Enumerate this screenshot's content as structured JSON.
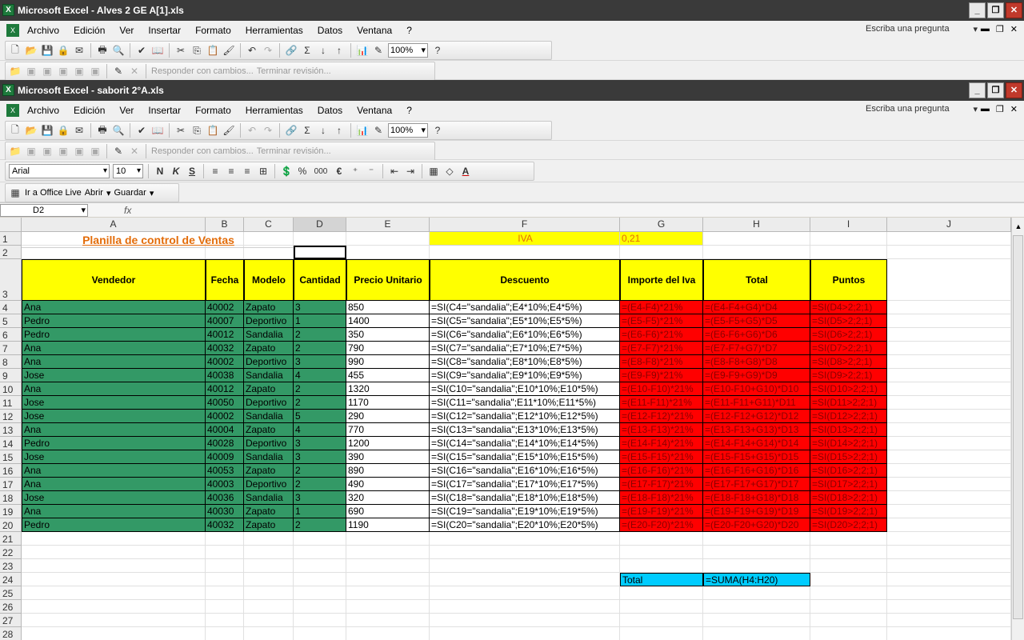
{
  "window1": {
    "title": "Microsoft Excel - Alves 2 GE A[1].xls"
  },
  "window2": {
    "title": "Microsoft Excel - saborit 2°A.xls"
  },
  "menu": {
    "items": [
      "Archivo",
      "Edición",
      "Ver",
      "Insertar",
      "Formato",
      "Herramientas",
      "Datos",
      "Ventana",
      "?"
    ],
    "ask_placeholder": "Escriba una pregunta"
  },
  "toolbar": {
    "zoom": "100%",
    "review_reply": "Responder con cambios...",
    "review_end": "Terminar revisión...",
    "font_name": "Arial",
    "font_size": "10",
    "bold": "N",
    "italic": "K",
    "underline": "S",
    "percent": "%",
    "thousands": "000",
    "euro": "€"
  },
  "office_live": {
    "go": "Ir a Office Live",
    "open": "Abrir",
    "save": "Guardar"
  },
  "formula_bar": {
    "name_box": "D2",
    "fx": "fx"
  },
  "sheet": {
    "columns": [
      "A",
      "B",
      "C",
      "D",
      "E",
      "F",
      "G",
      "H",
      "I",
      "J"
    ],
    "title": "Planilla de control de Ventas",
    "iva_label": "IVA",
    "iva_value": "0,21",
    "headers": [
      "Vendedor",
      "Fecha",
      "Modelo",
      "Cantidad",
      "Precio Unitario",
      "Descuento",
      "Importe del Iva",
      "Total",
      "Puntos"
    ],
    "rows": [
      [
        "Ana",
        "40002",
        "Zapato",
        "3",
        "850",
        "=SI(C4=\"sandalia\";E4*10%;E4*5%)",
        "=(E4-F4)*21%",
        "=(E4-F4+G4)*D4",
        "=SI(D4>2;2;1)"
      ],
      [
        "Pedro",
        "40007",
        "Deportivo",
        "1",
        "1400",
        "=SI(C5=\"sandalia\";E5*10%;E5*5%)",
        "=(E5-F5)*21%",
        "=(E5-F5+G5)*D5",
        "=SI(D5>2;2;1)"
      ],
      [
        "Pedro",
        "40012",
        "Sandalia",
        "2",
        "350",
        "=SI(C6=\"sandalia\";E6*10%;E6*5%)",
        "=(E6-F6)*21%",
        "=(E6-F6+G6)*D6",
        "=SI(D6>2;2;1)"
      ],
      [
        "Ana",
        "40032",
        "Zapato",
        "2",
        "790",
        "=SI(C7=\"sandalia\";E7*10%;E7*5%)",
        "=(E7-F7)*21%",
        "=(E7-F7+G7)*D7",
        "=SI(D7>2;2;1)"
      ],
      [
        "Ana",
        "40002",
        "Deportivo",
        "3",
        "990",
        "=SI(C8=\"sandalia\";E8*10%;E8*5%)",
        "=(E8-F8)*21%",
        "=(E8-F8+G8)*D8",
        "=SI(D8>2;2;1)"
      ],
      [
        "Jose",
        "40038",
        "Sandalia",
        "4",
        "455",
        "=SI(C9=\"sandalia\";E9*10%;E9*5%)",
        "=(E9-F9)*21%",
        "=(E9-F9+G9)*D9",
        "=SI(D9>2;2;1)"
      ],
      [
        "Ana",
        "40012",
        "Zapato",
        "2",
        "1320",
        "=SI(C10=\"sandalia\";E10*10%;E10*5%)",
        "=(E10-F10)*21%",
        "=(E10-F10+G10)*D10",
        "=SI(D10>2;2;1)"
      ],
      [
        "Jose",
        "40050",
        "Deportivo",
        "2",
        "1170",
        "=SI(C11=\"sandalia\";E11*10%;E11*5%)",
        "=(E11-F11)*21%",
        "=(E11-F11+G11)*D11",
        "=SI(D11>2;2;1)"
      ],
      [
        "Jose",
        "40002",
        "Sandalia",
        "5",
        "290",
        "=SI(C12=\"sandalia\";E12*10%;E12*5%)",
        "=(E12-F12)*21%",
        "=(E12-F12+G12)*D12",
        "=SI(D12>2;2;1)"
      ],
      [
        "Ana",
        "40004",
        "Zapato",
        "4",
        "770",
        "=SI(C13=\"sandalia\";E13*10%;E13*5%)",
        "=(E13-F13)*21%",
        "=(E13-F13+G13)*D13",
        "=SI(D13>2;2;1)"
      ],
      [
        "Pedro",
        "40028",
        "Deportivo",
        "3",
        "1200",
        "=SI(C14=\"sandalia\";E14*10%;E14*5%)",
        "=(E14-F14)*21%",
        "=(E14-F14+G14)*D14",
        "=SI(D14>2;2;1)"
      ],
      [
        "Jose",
        "40009",
        "Sandalia",
        "3",
        "390",
        "=SI(C15=\"sandalia\";E15*10%;E15*5%)",
        "=(E15-F15)*21%",
        "=(E15-F15+G15)*D15",
        "=SI(D15>2;2;1)"
      ],
      [
        "Ana",
        "40053",
        "Zapato",
        "2",
        "890",
        "=SI(C16=\"sandalia\";E16*10%;E16*5%)",
        "=(E16-F16)*21%",
        "=(E16-F16+G16)*D16",
        "=SI(D16>2;2;1)"
      ],
      [
        "Ana",
        "40003",
        "Deportivo",
        "2",
        "490",
        "=SI(C17=\"sandalia\";E17*10%;E17*5%)",
        "=(E17-F17)*21%",
        "=(E17-F17+G17)*D17",
        "=SI(D17>2;2;1)"
      ],
      [
        "Jose",
        "40036",
        "Sandalia",
        "3",
        "320",
        "=SI(C18=\"sandalia\";E18*10%;E18*5%)",
        "=(E18-F18)*21%",
        "=(E18-F18+G18)*D18",
        "=SI(D18>2;2;1)"
      ],
      [
        "Ana",
        "40030",
        "Zapato",
        "1",
        "690",
        "=SI(C19=\"sandalia\";E19*10%;E19*5%)",
        "=(E19-F19)*21%",
        "=(E19-F19+G19)*D19",
        "=SI(D19>2;2;1)"
      ],
      [
        "Pedro",
        "40032",
        "Zapato",
        "2",
        "1190",
        "=SI(C20=\"sandalia\";E20*10%;E20*5%)",
        "=(E20-F20)*21%",
        "=(E20-F20+G20)*D20",
        "=SI(D20>2;2;1)"
      ]
    ],
    "total_label": "Total",
    "total_formula": "=SUMA(H4:H20)",
    "row_numbers": [
      "1",
      "2",
      "3",
      "4",
      "5",
      "6",
      "7",
      "8",
      "9",
      "10",
      "11",
      "12",
      "13",
      "14",
      "15",
      "16",
      "17",
      "18",
      "19",
      "20",
      "21",
      "22",
      "23",
      "24",
      "25",
      "26",
      "27",
      "28"
    ]
  },
  "colors": {
    "header_yellow": "#ffff00",
    "data_green": "#339966",
    "formula_red": "#ff0000",
    "total_cyan": "#00ccff",
    "title_orange": "#e36c09"
  }
}
